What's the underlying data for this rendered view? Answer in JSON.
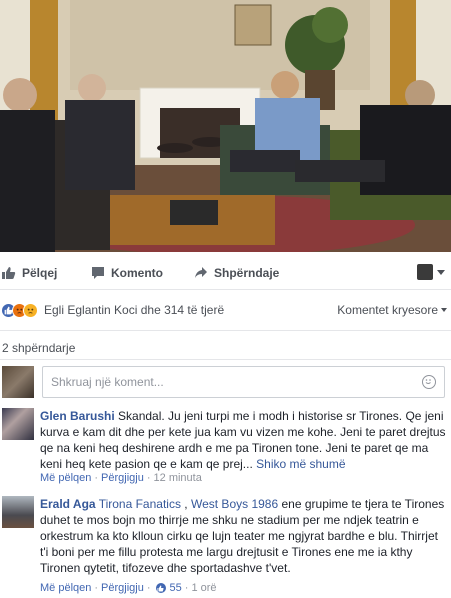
{
  "post_actions": {
    "like": "Pëlqej",
    "comment": "Komento",
    "share": "Shpërndaje"
  },
  "reactions": {
    "summary": "Egli Eglantin Koci dhe 314 të tjerë",
    "sort": "Komentet kryesore"
  },
  "shares": "2 shpërndarje",
  "composer": {
    "placeholder": "Shkruaj një koment..."
  },
  "comments": [
    {
      "author": "Glen Barushi",
      "text": " Skandal. Ju jeni turpi me i modh i historise sr Tirones. Qe jeni kurva e kam dit dhe per kete jua kam vu vizen me kohe. Jeni te paret drejtus qe na keni heq deshirene ardh e me pa Tironen tone. Jeni te paret qe ma keni heq kete pasion qe e kam qe prej... ",
      "more": "Shiko më shumë",
      "like": "Më pëlqen",
      "reply": "Përgjigju",
      "time": "12 minuta"
    },
    {
      "author": "Erald Aga",
      "tag": "Tirona Fanatics",
      "tag2": "West Boys 1986",
      "text": " ene grupime te tjera te Tirones duhet te mos bojn mo thirrje me shku ne stadium per me ndjek teatrin e orkestrum ka kto klloun cirku qe lujn teater me ngjyrat bardhe e blu. Thirrjet t'i boni per me fillu protesta me largu drejtusit e Tirones ene me ia kthy Tironen qytetit, tifozeve dhe sportadashve t'vet.",
      "like": "Më pëlqen",
      "reply": "Përgjigju",
      "likes": "55",
      "time": "1 orë"
    }
  ],
  "colors": {
    "link": "#365899",
    "meta": "#90949c",
    "like_blue": "#4267b2"
  }
}
